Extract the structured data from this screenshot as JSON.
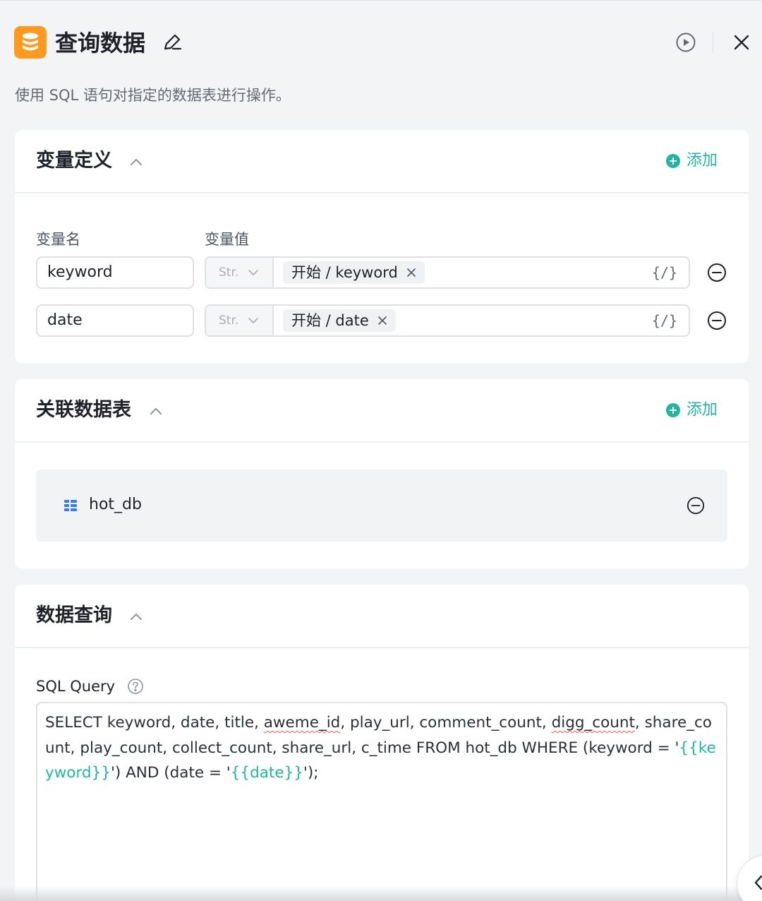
{
  "header": {
    "title": "查询数据",
    "icons": {
      "app": "database-icon",
      "edit": "pencil-icon",
      "run": "play-circle-icon",
      "close": "close-icon"
    },
    "app_icon_color": "#ff9a1f"
  },
  "description": "使用 SQL 语句对指定的数据表进行操作。",
  "variables_section": {
    "title": "变量定义",
    "add_label": "添加",
    "name_column": "变量名",
    "value_column": "变量值",
    "rows": [
      {
        "name": "keyword",
        "type": "Str.",
        "value_tag": "开始 / keyword",
        "expr_button": "{/}"
      },
      {
        "name": "date",
        "type": "Str.",
        "value_tag": "开始 / date",
        "expr_button": "{/}"
      }
    ]
  },
  "tables_section": {
    "title": "关联数据表",
    "add_label": "添加",
    "tables": [
      {
        "name": "hot_db"
      }
    ]
  },
  "query_section": {
    "title": "数据查询",
    "sql_label": "SQL Query",
    "sql": {
      "part1": "SELECT keyword, date, title, ",
      "typo1": "aweme_id",
      "part2": ", play_url, comment_count, ",
      "typo2": "digg_count",
      "part3": ", share_count, play_count, collect_count, share_url, c_time FROM hot_db WHERE (keyword = '",
      "var1": "{{keyword}}",
      "part4": "') AND (date =  '",
      "var2": "{{date}}",
      "part5": "');"
    }
  },
  "colors": {
    "accent": "#1fb89e",
    "card_bg": "#ffffff",
    "page_bg": "#f3f4f6"
  }
}
